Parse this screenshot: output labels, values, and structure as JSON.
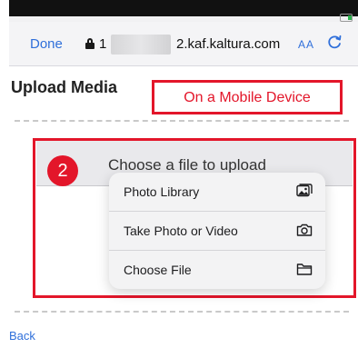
{
  "colors": {
    "link_blue": "#2f6fda",
    "annotation_red": "#e3162a",
    "menu_background": "#f3f3f4"
  },
  "browser": {
    "done_label": "Done",
    "url_prefix": "1",
    "url_suffix": "2.kaf.kaltura.com",
    "text_size_label": "AA",
    "lock_icon": "lock-icon",
    "reload_icon": "reload-icon"
  },
  "page": {
    "title": "Upload Media",
    "annotation_label": "On a Mobile Device",
    "step_number": "2",
    "upload_label": "Choose a file to upload",
    "back_label": "Back"
  },
  "menu": {
    "items": [
      {
        "label": "Photo Library",
        "icon": "photo-library-icon"
      },
      {
        "label": "Take Photo or Video",
        "icon": "camera-icon"
      },
      {
        "label": "Choose File",
        "icon": "folder-icon"
      }
    ]
  }
}
